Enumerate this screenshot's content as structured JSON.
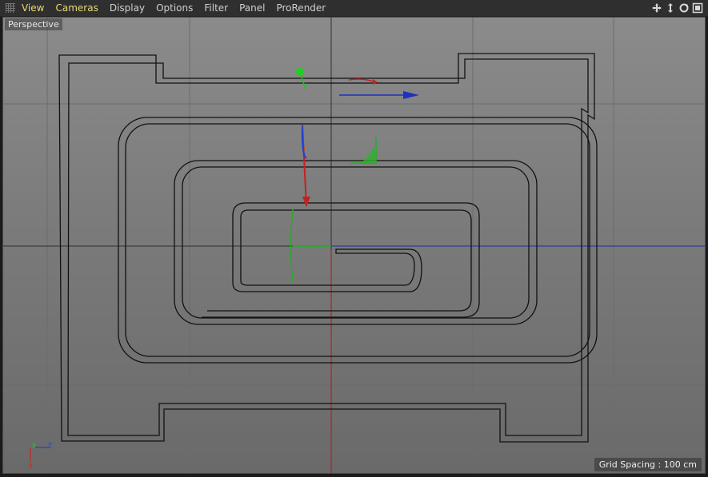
{
  "menu": {
    "items": [
      "View",
      "Cameras",
      "Display",
      "Options",
      "Filter",
      "Panel",
      "ProRender"
    ],
    "highlighted": [
      "View",
      "Cameras"
    ]
  },
  "nav_icons": [
    "move-view-icon",
    "dolly-view-icon",
    "rotate-view-icon",
    "toggle-view-icon"
  ],
  "viewport": {
    "camera_label": "Perspective",
    "grid_spacing": "Grid Spacing : 100 cm",
    "axis_labels": {
      "y": "Y",
      "z": "Z",
      "x": "X"
    }
  },
  "colors": {
    "x_axis": "#cc2020",
    "y_axis": "#20c020",
    "z_axis": "#2020cc",
    "spline": "#111111",
    "menu_highlight": "#e8d878"
  }
}
